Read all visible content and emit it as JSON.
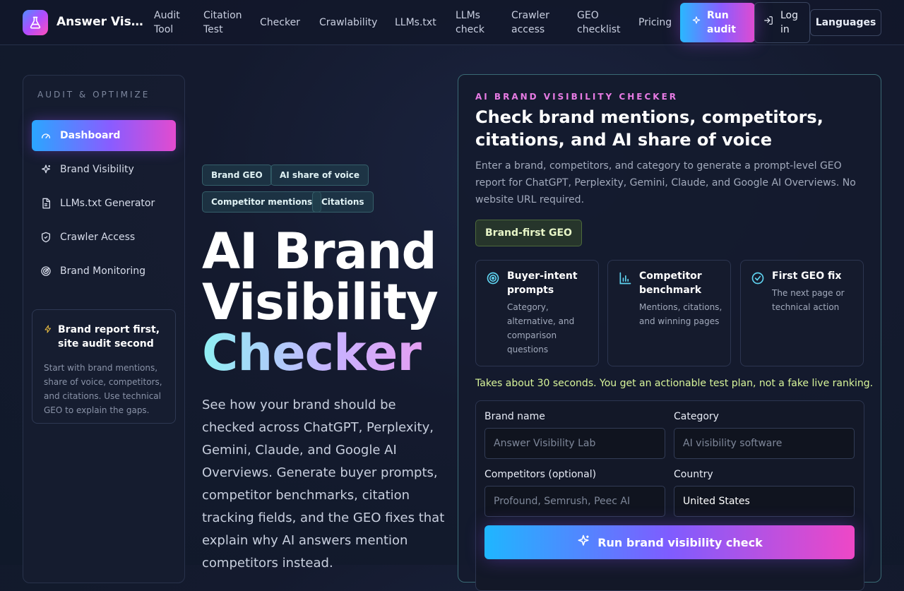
{
  "header": {
    "brand": "Answer Visibility Lab",
    "nav": [
      {
        "label": "Audit Tool"
      },
      {
        "label": "Citation Test"
      },
      {
        "label": "Checker"
      },
      {
        "label": "Crawlability"
      },
      {
        "label": "LLMs.txt"
      },
      {
        "label": "LLMs check"
      },
      {
        "label": "Crawler access"
      },
      {
        "label": "GEO checklist"
      },
      {
        "label": "Pricing"
      }
    ],
    "run_audit": "Run audit",
    "login": "Log in",
    "languages": "Languages"
  },
  "sidebar": {
    "heading": "AUDIT & OPTIMIZE",
    "items": [
      {
        "label": "Dashboard",
        "icon": "gauge-icon"
      },
      {
        "label": "Brand Visibility",
        "icon": "sparkle-icon"
      },
      {
        "label": "LLMs.txt Generator",
        "icon": "file-icon"
      },
      {
        "label": "Crawler Access",
        "icon": "shield-icon"
      },
      {
        "label": "Brand Monitoring",
        "icon": "radar-icon"
      }
    ],
    "card": {
      "title": "Brand report first, site audit second",
      "text": "Start with brand mentions, share of voice, competitors, and citations. Use technical GEO to explain the gaps."
    }
  },
  "hero": {
    "chips": [
      "Brand GEO",
      "AI share of voice",
      "Competitor mentions",
      "Citations"
    ],
    "title_line1": "AI Brand",
    "title_line2": "Visibility",
    "title_line3": "Checker",
    "description": "See how your brand should be checked across ChatGPT, Perplexity, Gemini, Claude, and Google AI Overviews. Generate buyer prompts, competitor benchmarks, citation tracking fields, and the GEO fixes that explain why AI answers mention competitors instead."
  },
  "panel": {
    "eyebrow": "AI BRAND VISIBILITY CHECKER",
    "title": "Check brand mentions, competitors, citations, and AI share of voice",
    "description": "Enter a brand, competitors, and category to generate a prompt-level GEO report for ChatGPT, Perplexity, Gemini, Claude, and Google AI Overviews. No website URL required.",
    "badge": "Brand-first GEO",
    "features": [
      {
        "title": "Buyer-intent prompts",
        "text": "Category, alternative, and comparison questions",
        "icon": "target-icon"
      },
      {
        "title": "Competitor benchmark",
        "text": "Mentions, citations, and winning pages",
        "icon": "bar-chart-icon"
      },
      {
        "title": "First GEO fix",
        "text": "The next page or technical action",
        "icon": "check-circle-icon"
      }
    ],
    "note": "Takes about 30 seconds. You get an actionable test plan, not a fake live ranking.",
    "form": {
      "brand_label": "Brand name",
      "brand_placeholder": "Answer Visibility Lab",
      "category_label": "Category",
      "category_placeholder": "AI visibility software",
      "competitors_label": "Competitors (optional)",
      "competitors_placeholder": "Profound, Semrush, Peec AI",
      "country_label": "Country",
      "country_value": "United States",
      "submit": "Run brand visibility check"
    }
  },
  "colors": {
    "accent_gradient_start": "#29b8ff",
    "accent_gradient_mid": "#8a5cff",
    "accent_gradient_end": "#e04bd0",
    "eyebrow": "#e87be4",
    "note": "#d8f59a",
    "chip_border": "#355f6a"
  }
}
